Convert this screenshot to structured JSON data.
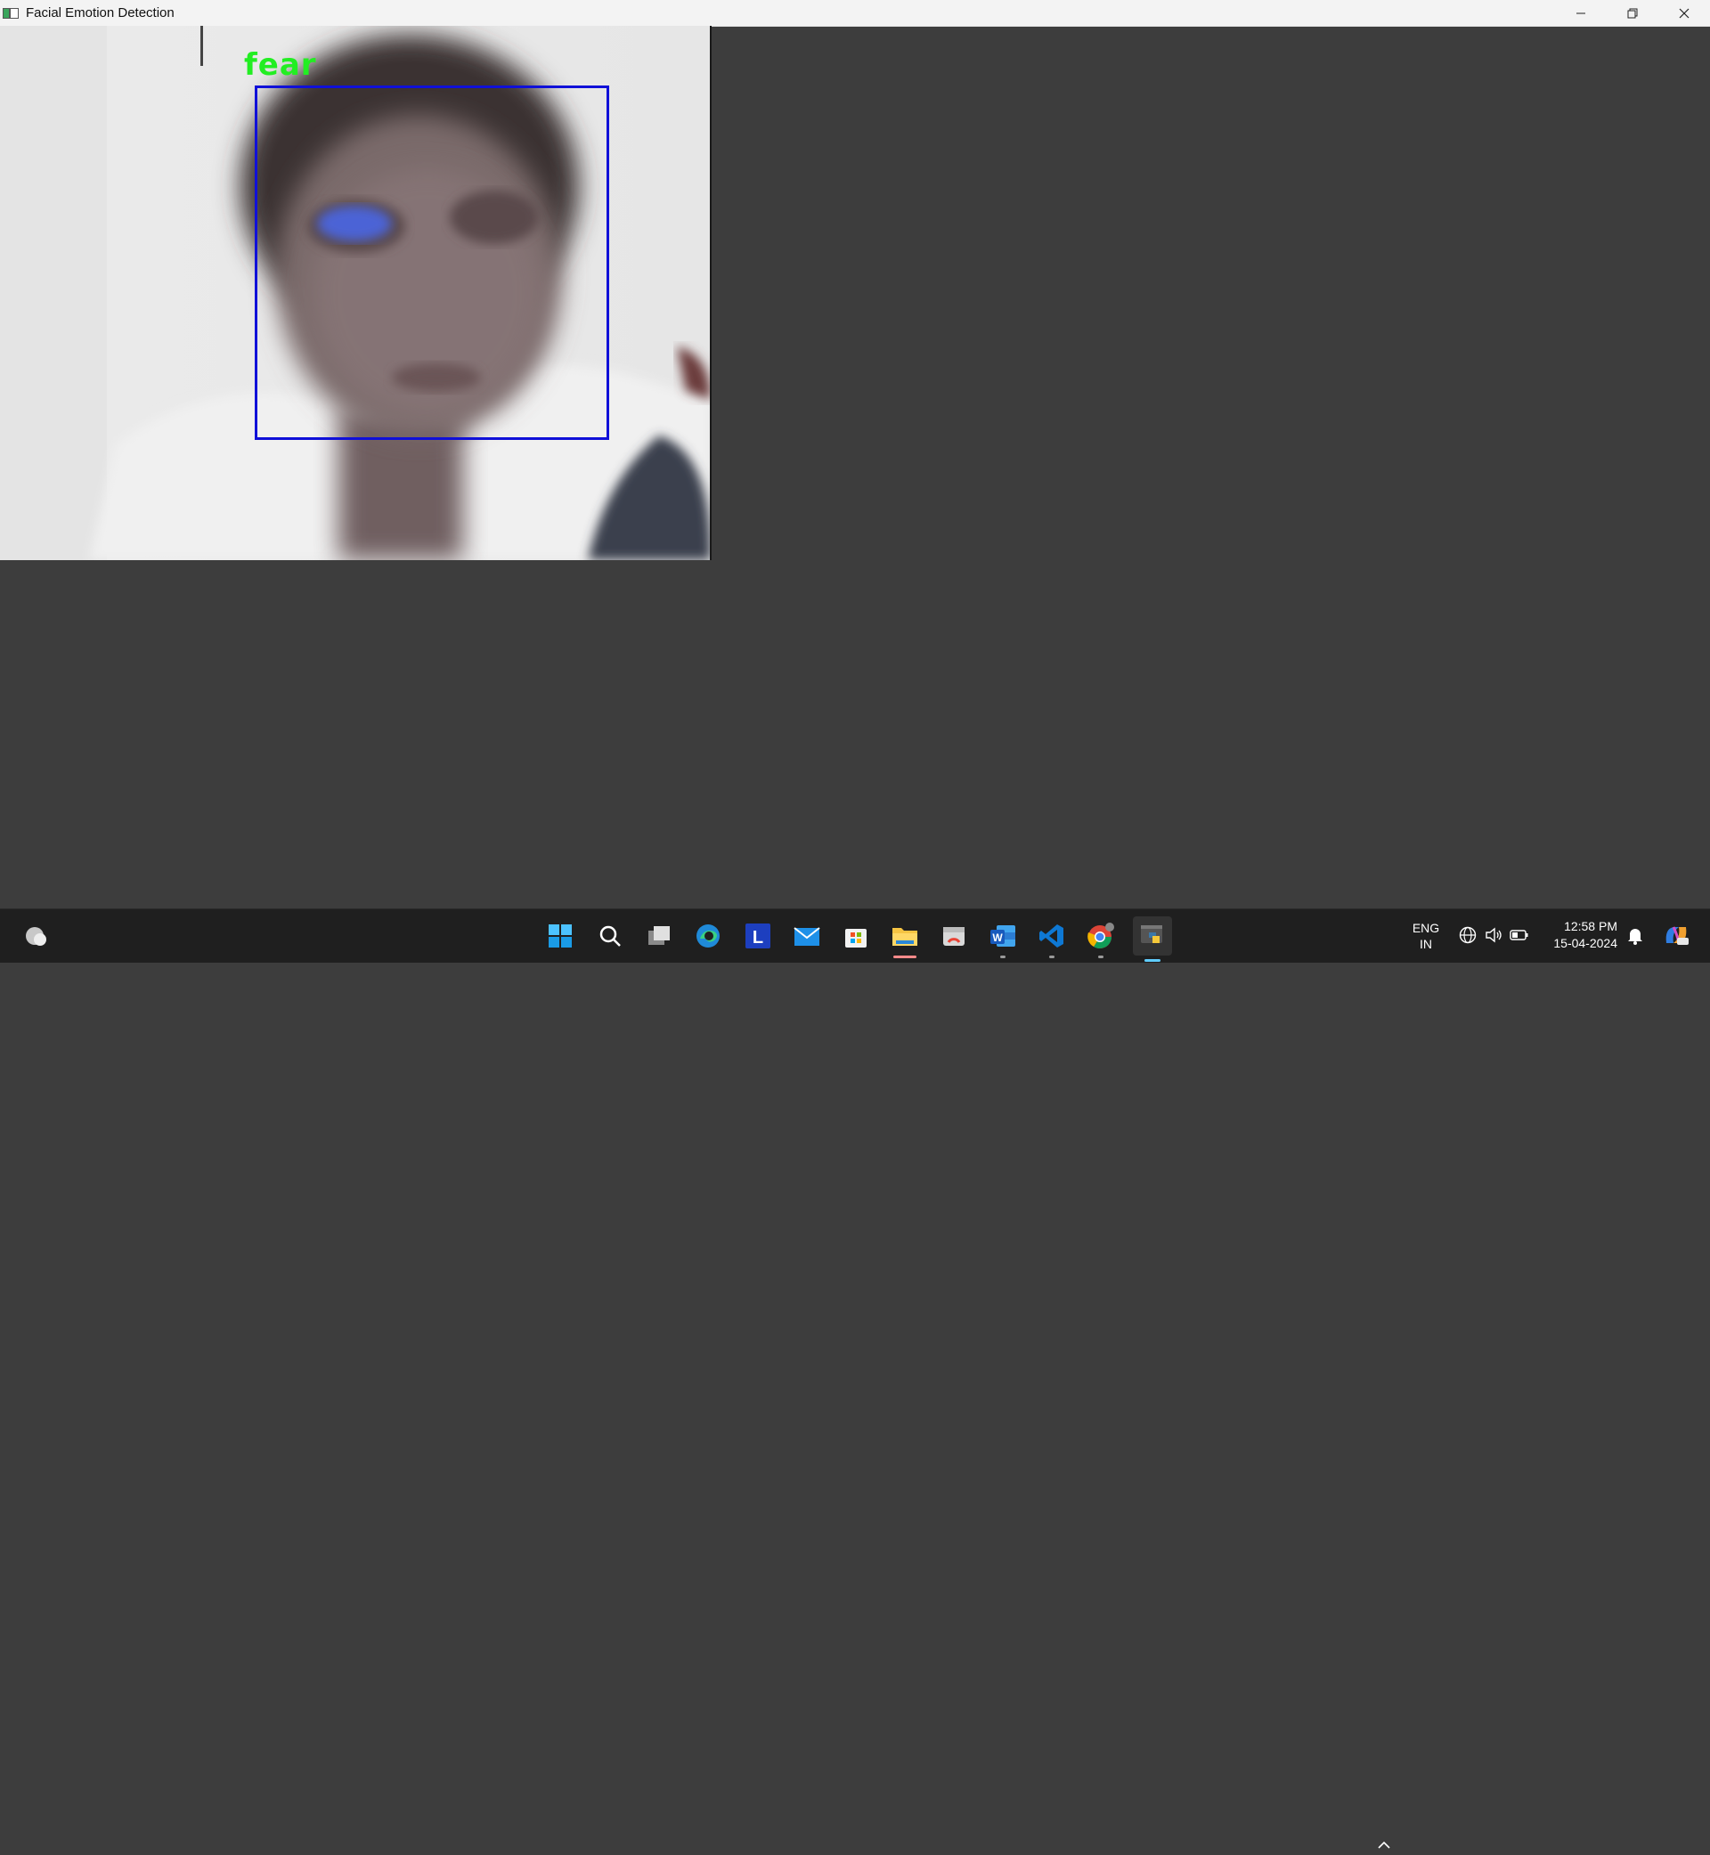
{
  "window": {
    "title": "Facial Emotion Detection"
  },
  "detection": {
    "emotion_label": "fear"
  },
  "taskbar": {
    "language_line1": "ENG",
    "language_line2": "IN",
    "time": "12:58 PM",
    "date": "15-04-2024",
    "apps": [
      {
        "name": "widgets-icon"
      },
      {
        "name": "start-icon"
      },
      {
        "name": "search-icon"
      },
      {
        "name": "task-view-icon"
      },
      {
        "name": "edge-icon"
      },
      {
        "name": "app-l-icon",
        "label": "L"
      },
      {
        "name": "mail-icon"
      },
      {
        "name": "microsoft-store-icon"
      },
      {
        "name": "file-explorer-icon"
      },
      {
        "name": "app-icon"
      },
      {
        "name": "word-icon",
        "label": "W"
      },
      {
        "name": "vscode-icon"
      },
      {
        "name": "chrome-icon"
      },
      {
        "name": "python-icon"
      }
    ]
  },
  "colors": {
    "background": "#3d3d3d",
    "face_box": "#1010d8",
    "label": "#22ee22",
    "taskbar": "#1f1f1f"
  }
}
